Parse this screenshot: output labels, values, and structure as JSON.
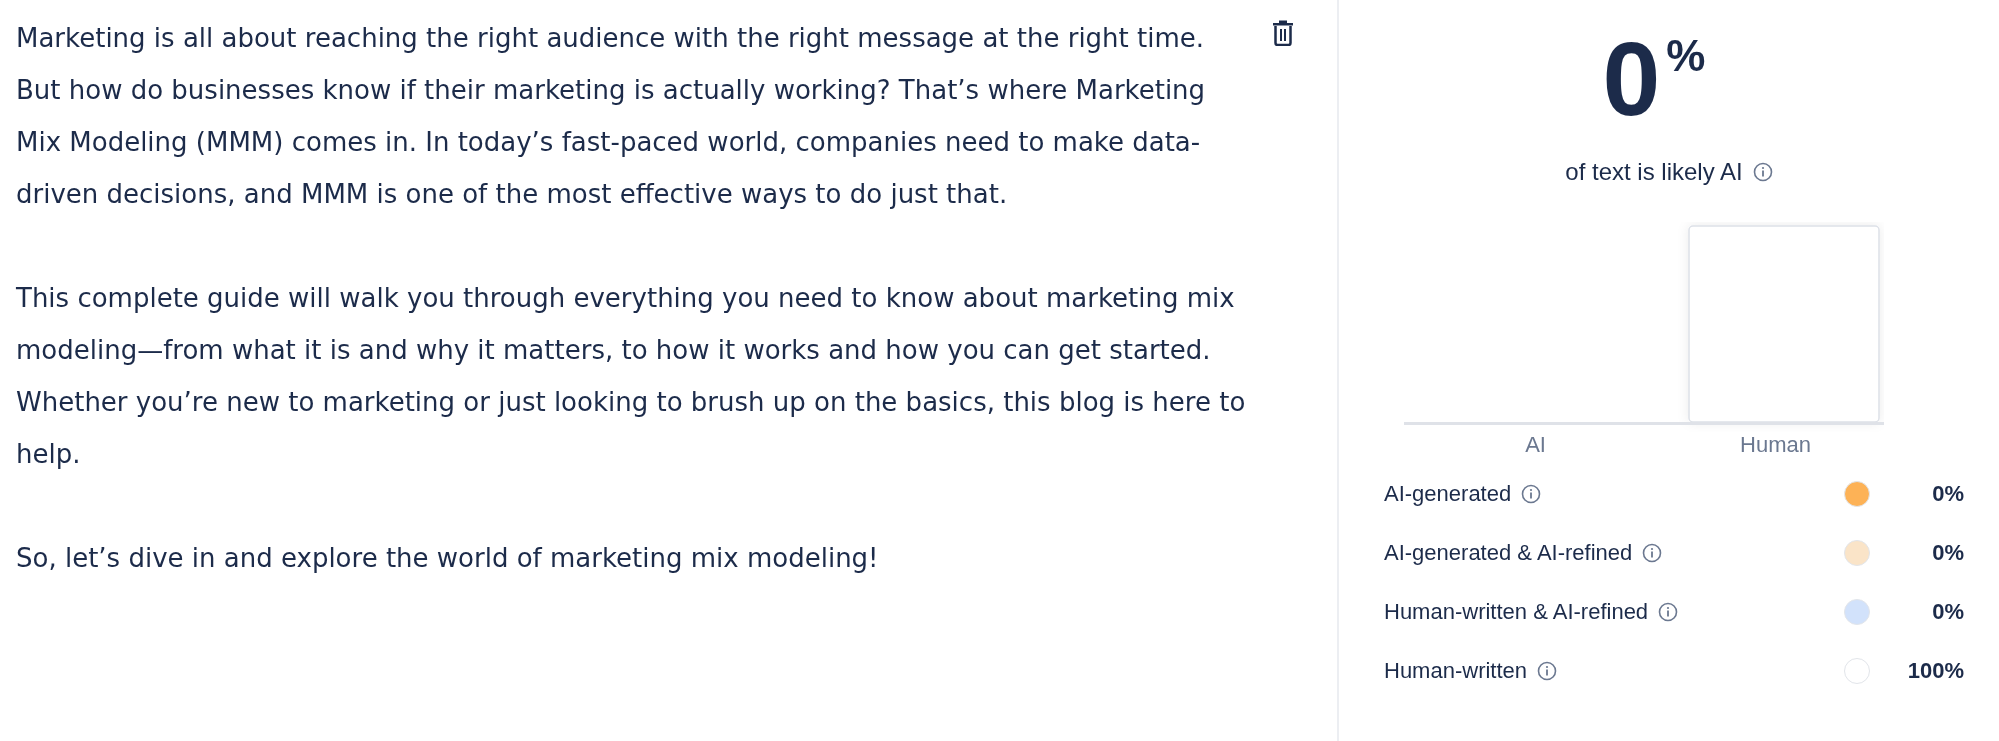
{
  "editor": {
    "paragraphs": [
      "Marketing is all about reaching the right audience with the right message at the right time. But how do businesses know if their marketing is actually working? That’s where Marketing Mix Modeling (MMM) comes in. In today’s fast-paced world, companies need to make data-driven decisions, and MMM is one of the most effective ways to do just that.",
      "This complete guide will walk you through everything you need to know about marketing mix modeling—from what it is and why it matters, to how it works and how you can get started. Whether you’re new to marketing or just looking to brush up on the basics, this blog is here to help.",
      "So, let’s dive in and explore the world of marketing mix modeling!"
    ]
  },
  "result": {
    "score": "0",
    "unit": "%",
    "caption": "of text is likely AI",
    "axis_labels": [
      "AI",
      "Human"
    ],
    "legend": [
      {
        "label": "AI-generated",
        "color": "#fdb256",
        "value": "0%"
      },
      {
        "label": "AI-generated & AI-refined",
        "color": "#fae4c8",
        "value": "0%"
      },
      {
        "label": "Human-written & AI-refined",
        "color": "#d2e2fb",
        "value": "0%"
      },
      {
        "label": "Human-written",
        "color": "#ffffff",
        "value": "100%"
      }
    ]
  }
}
